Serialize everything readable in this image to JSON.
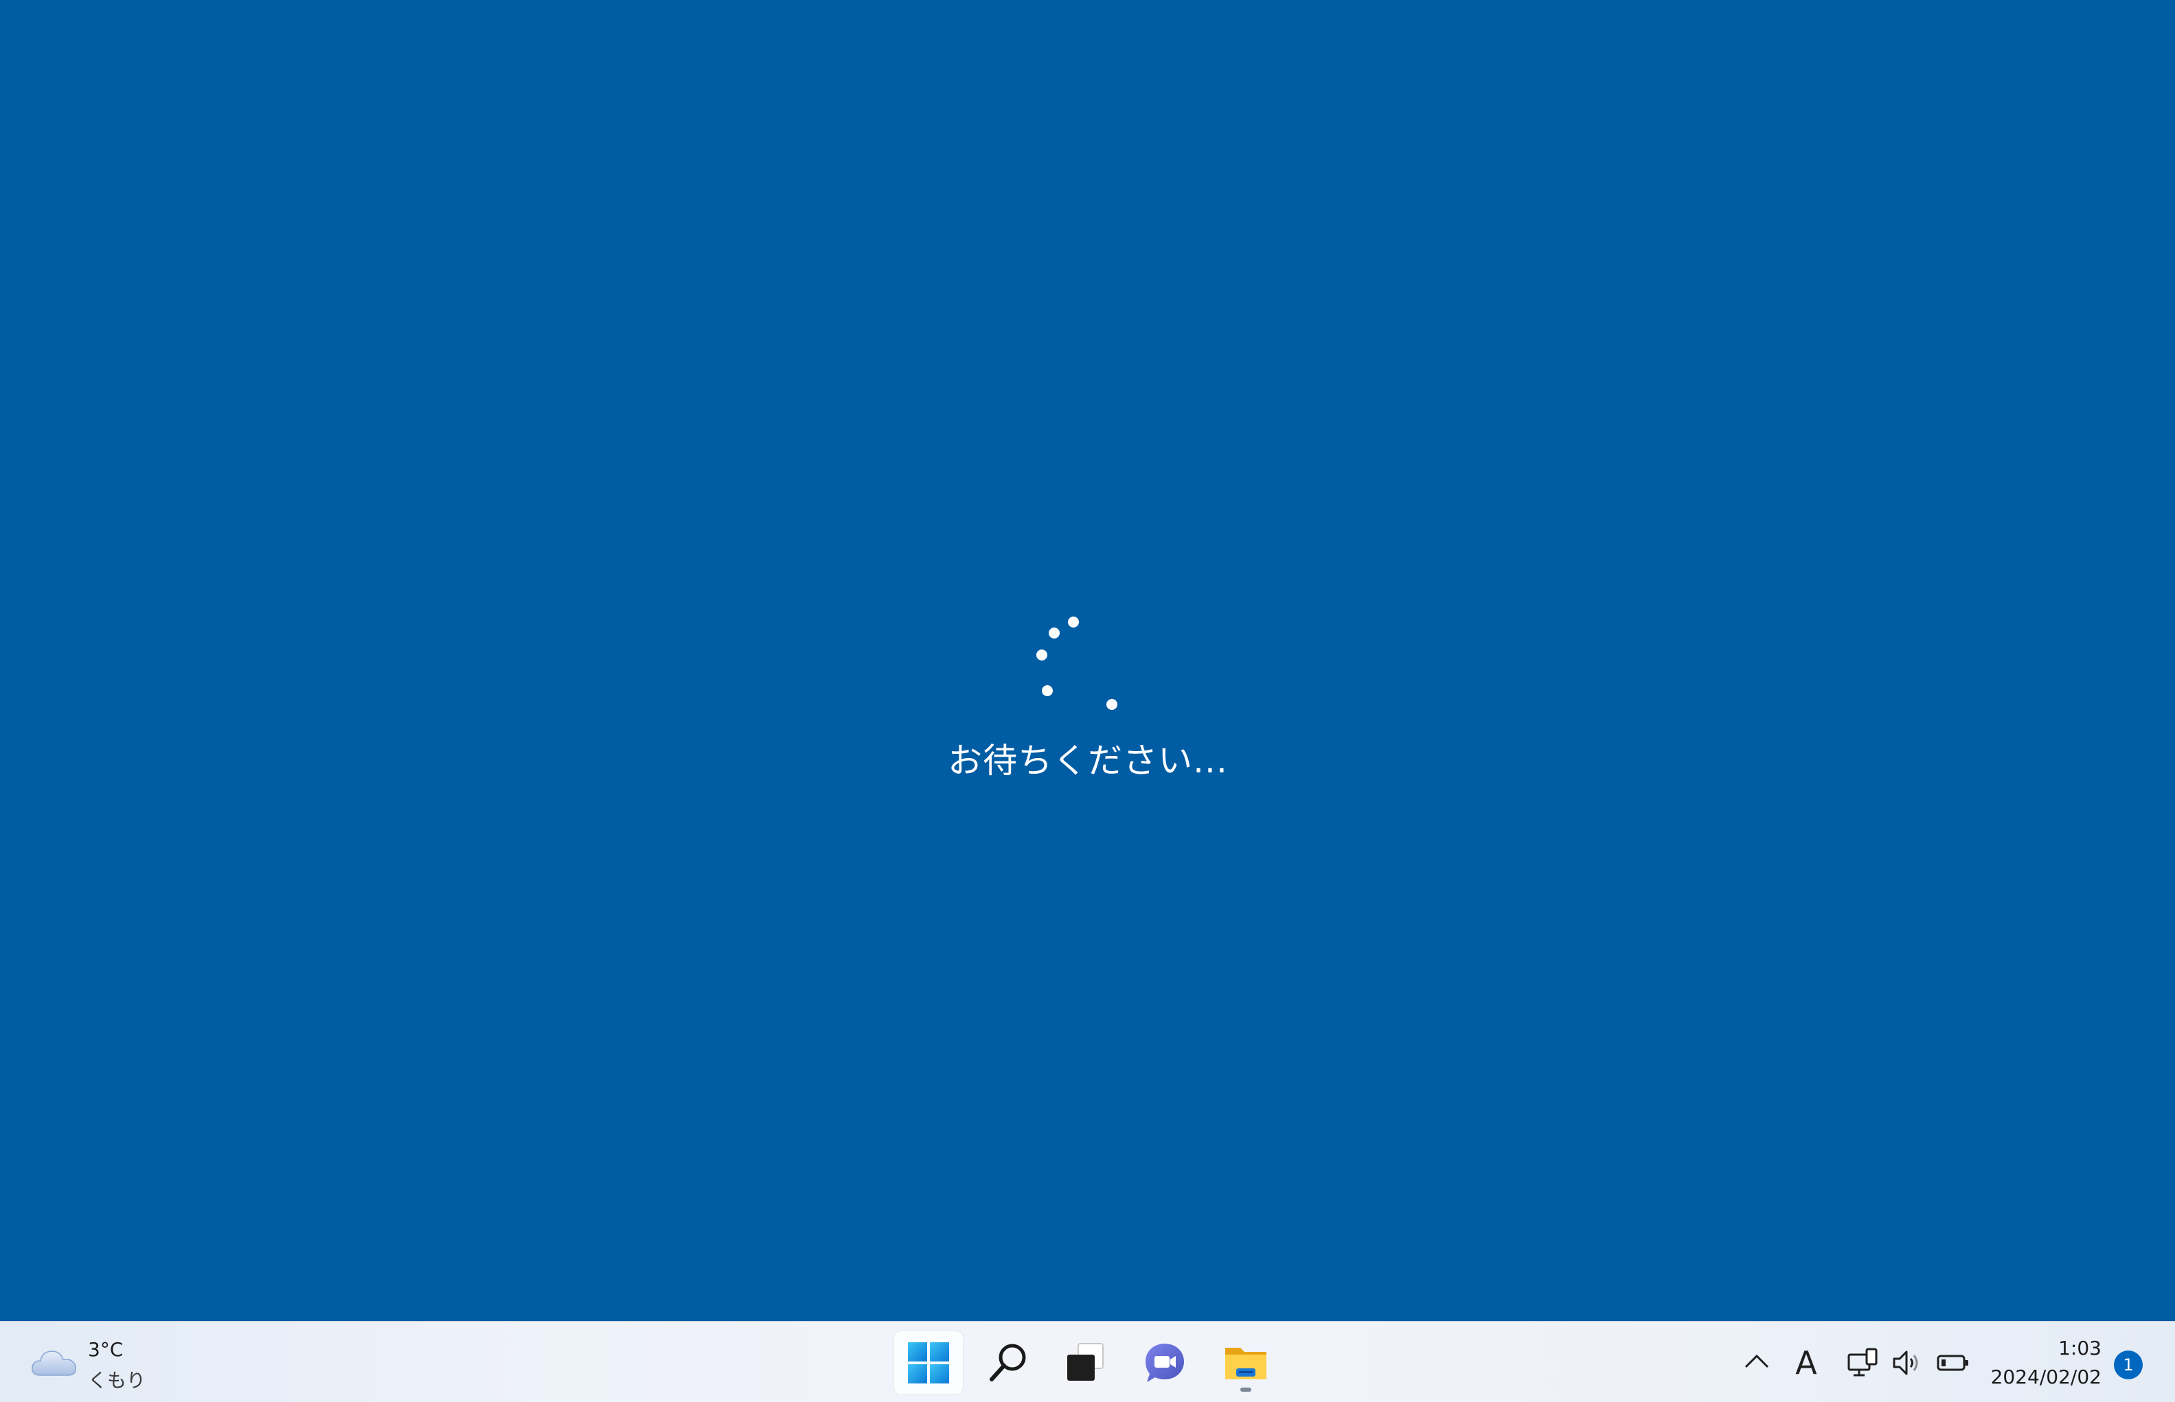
{
  "screen": {
    "background_color": "#005ca3",
    "loading_text": "お待ちください..."
  },
  "taskbar": {
    "weather": {
      "icon": "cloud-icon",
      "temperature": "3°C",
      "condition": "くもり"
    },
    "apps": [
      {
        "name": "start",
        "icon": "windows-logo-icon"
      },
      {
        "name": "search",
        "icon": "search-icon"
      },
      {
        "name": "task-view",
        "icon": "task-view-icon"
      },
      {
        "name": "chat",
        "icon": "teams-chat-icon"
      },
      {
        "name": "file-explorer",
        "icon": "folder-icon",
        "running": true
      }
    ],
    "tray": {
      "overflow_icon": "chevron-up-icon",
      "ime_label": "A",
      "network_icon": "network-icon",
      "volume_icon": "speaker-icon",
      "battery_icon": "battery-icon"
    },
    "clock": {
      "time": "1:03",
      "date": "2024/02/02"
    },
    "notification_count": "1"
  }
}
